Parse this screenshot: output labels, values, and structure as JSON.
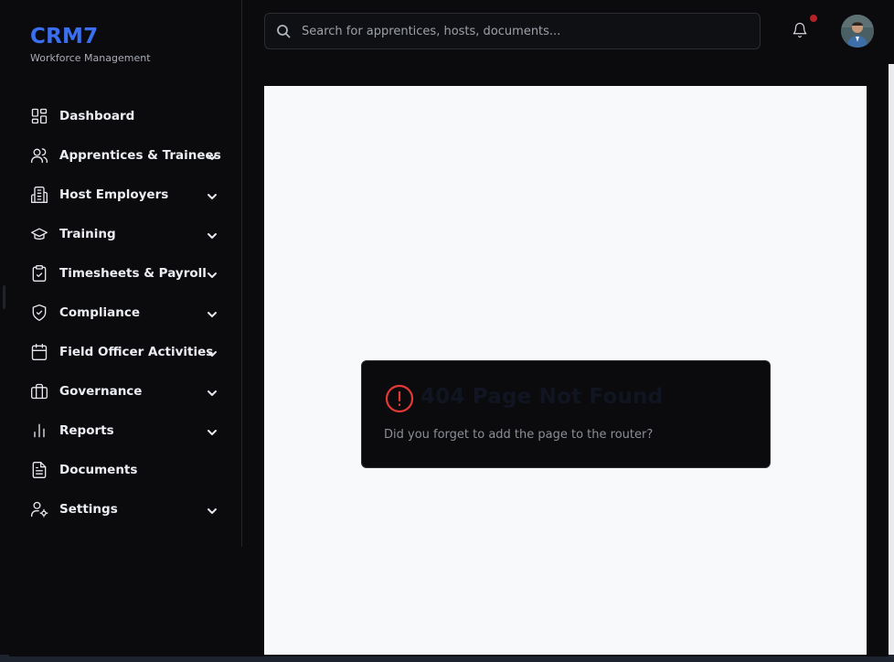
{
  "brand": {
    "name": "CRM7",
    "subtitle": "Workforce Management"
  },
  "search": {
    "placeholder": "Search for apprentices, hosts, documents...",
    "value": ""
  },
  "sidebar": {
    "items": [
      {
        "label": "Dashboard",
        "icon": "dashboard-icon",
        "expandable": false
      },
      {
        "label": "Apprentices & Trainees",
        "icon": "users-icon",
        "expandable": true
      },
      {
        "label": "Host Employers",
        "icon": "building-icon",
        "expandable": true
      },
      {
        "label": "Training",
        "icon": "graduation-cap-icon",
        "expandable": true
      },
      {
        "label": "Timesheets & Payroll",
        "icon": "clipboard-check-icon",
        "expandable": true
      },
      {
        "label": "Compliance",
        "icon": "shield-check-icon",
        "expandable": true
      },
      {
        "label": "Field Officer Activities",
        "icon": "calendar-icon",
        "expandable": true
      },
      {
        "label": "Governance",
        "icon": "briefcase-icon",
        "expandable": true
      },
      {
        "label": "Reports",
        "icon": "bar-chart-icon",
        "expandable": true
      },
      {
        "label": "Documents",
        "icon": "document-icon",
        "expandable": false
      },
      {
        "label": "Settings",
        "icon": "user-settings-icon",
        "expandable": true
      }
    ]
  },
  "error": {
    "title": "404 Page Not Found",
    "message": "Did you forget to add the page to the router?",
    "icon": "alert-circle-icon"
  },
  "colors": {
    "accent": "#3b6ff2",
    "error": "#e53935",
    "notification": "#b42226",
    "background": "#0b0b0e",
    "content": "#f8f9fb"
  }
}
